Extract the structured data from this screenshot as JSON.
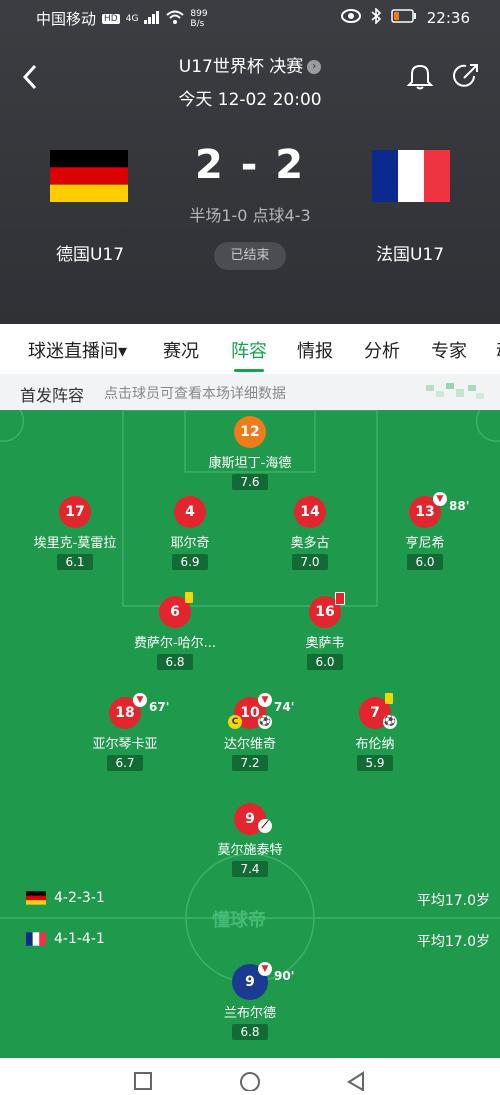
{
  "status_bar": {
    "carrier": "中国移动",
    "hd": "HD",
    "net": "4G",
    "speed_value": "899",
    "speed_unit": "B/s",
    "time": "22:36"
  },
  "header": {
    "title": "U17世界杯 决赛",
    "datetime": "今天 12-02 20:00",
    "score": "2 - 2",
    "subscore": "半场1-0 点球4-3",
    "home_team": "德国U17",
    "away_team": "法国U17",
    "status": "已结束"
  },
  "tabs": [
    {
      "label": "球迷直播间▾"
    },
    {
      "label": "赛况"
    },
    {
      "label": "阵容"
    },
    {
      "label": "情报"
    },
    {
      "label": "分析"
    },
    {
      "label": "专家"
    },
    {
      "label": "动"
    }
  ],
  "lineup": {
    "title": "首发阵容",
    "hint": "点击球员可查看本场详细数据",
    "watermark": "懂球帝",
    "home_formation": "4-2-3-1",
    "away_formation": "4-1-4-1",
    "home_avg_age": "平均17.0岁",
    "away_avg_age": "平均17.0岁",
    "players": [
      {
        "number": "12",
        "name": "康斯坦丁-海德",
        "rating": "7.6"
      },
      {
        "number": "17",
        "name": "埃里克-莫雷拉",
        "rating": "6.1"
      },
      {
        "number": "4",
        "name": "耶尔奇",
        "rating": "6.9"
      },
      {
        "number": "14",
        "name": "奥多古",
        "rating": "7.0"
      },
      {
        "number": "13",
        "name": "亨尼希",
        "rating": "6.0",
        "sub_time": "88'"
      },
      {
        "number": "6",
        "name": "费萨尔-哈尔...",
        "rating": "6.8"
      },
      {
        "number": "16",
        "name": "奥萨韦",
        "rating": "6.0"
      },
      {
        "number": "18",
        "name": "亚尔琴卡亚",
        "rating": "6.7",
        "sub_time": "67'"
      },
      {
        "number": "10",
        "name": "达尔维奇",
        "rating": "7.2",
        "sub_time": "74'",
        "captain": "C"
      },
      {
        "number": "7",
        "name": "布伦纳",
        "rating": "5.9"
      },
      {
        "number": "9",
        "name": "莫尔施泰特",
        "rating": "7.4"
      },
      {
        "number": "9",
        "name": "兰布尔德",
        "rating": "6.8",
        "sub_time": "90'"
      }
    ]
  },
  "colors": {
    "accent": "#13a552",
    "pitch": "#1f9a4c",
    "header_bg": "#34363b",
    "player_red": "#e3262d",
    "goalkeeper_orange": "#f07b1a"
  }
}
